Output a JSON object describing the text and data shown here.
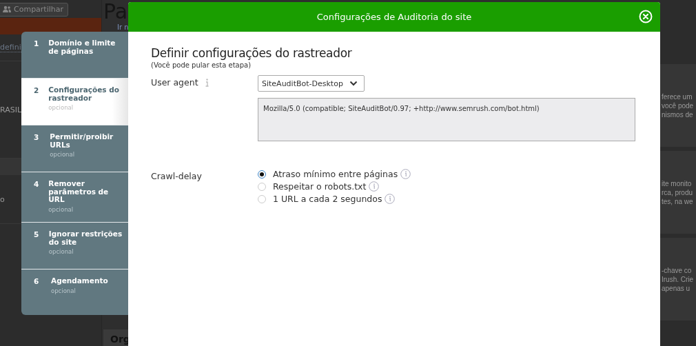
{
  "background": {
    "share_button": "Compartilhar",
    "heading": "Pa",
    "link": "Ir n",
    "left_texts": [
      {
        "kind": "link",
        "text": "defini"
      },
      {
        "kind": "text",
        "text": "RASIL"
      },
      {
        "kind": "text",
        "text": "o"
      }
    ],
    "bottom_label": "Org",
    "cards": [
      {
        "lines": [
          "ferece um",
          "você pode",
          "nismos de"
        ]
      },
      {
        "lines": [
          "ite monito",
          "rca, produ",
          "tes, na we"
        ]
      },
      {
        "lines": [
          "-chave co",
          "Irush. Crie",
          "apenas u"
        ]
      }
    ]
  },
  "steps": [
    {
      "number": "1",
      "title": "Domínio e limite de páginas",
      "selected": false
    },
    {
      "number": "2",
      "title": "Configurações do rastreador",
      "note": "opcional",
      "selected": true
    },
    {
      "number": "3",
      "title": "Permitir/proibir URLs",
      "note": "opcional",
      "selected": false
    },
    {
      "number": "4",
      "title": "Remover parâmetros de URL",
      "note": "opcional",
      "selected": false
    },
    {
      "number": "5",
      "title": "Ignorar restrições do site",
      "note": "opcional",
      "selected": false
    },
    {
      "number": "6",
      "title": "Agendamento",
      "note": "opcional",
      "selected": false
    }
  ],
  "modal": {
    "title": "Configurações de Auditoria do site",
    "heading": "Definir configurações do rastreador",
    "subheading": "(Você pode pular esta etapa)",
    "user_agent": {
      "label": "User agent",
      "value": "SiteAuditBot-Desktop",
      "string": "Mozilla/5.0 (compatible; SiteAuditBot/0.97; +http://www.semrush.com/bot.html)"
    },
    "crawl_delay": {
      "label": "Crawl-delay",
      "options": [
        {
          "label": "Atraso mínimo entre páginas",
          "selected": true
        },
        {
          "label": "Respeitar o robots.txt",
          "selected": false
        },
        {
          "label": "1 URL a cada 2 segundos",
          "selected": false
        }
      ]
    }
  }
}
